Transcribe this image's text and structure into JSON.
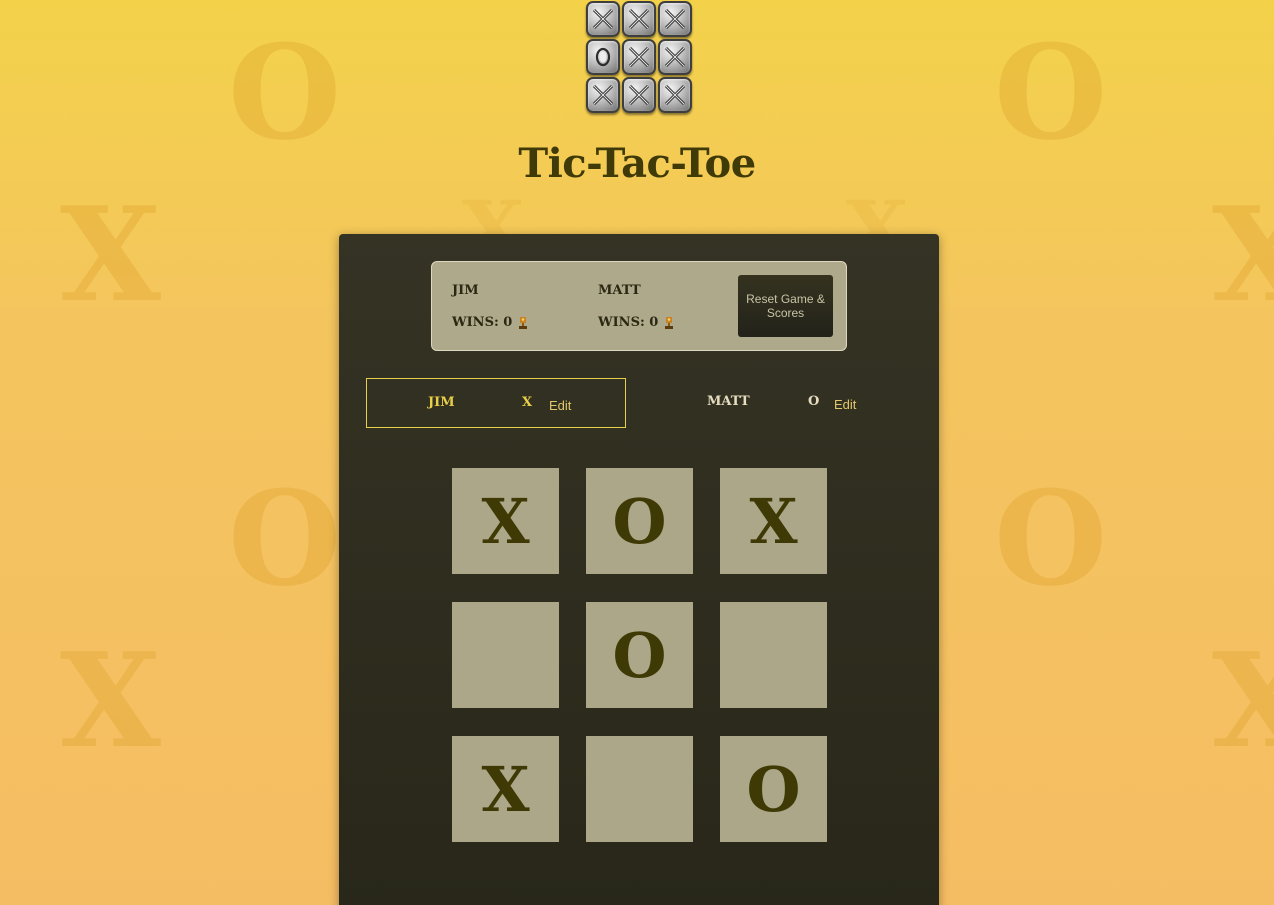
{
  "app": {
    "title": "Tic-Tac-Toe",
    "logo_icon": "tic-tac-toe-logo-icon",
    "logo_tiles": [
      "X",
      "X",
      "X",
      "O",
      "X",
      "X",
      "X",
      "X",
      "X"
    ]
  },
  "background": {
    "glyphs": [
      "O",
      "O",
      "X",
      "X",
      "O",
      "O",
      "X",
      "X",
      "X",
      "X"
    ]
  },
  "scoreboard": {
    "players": [
      {
        "name": "JIM",
        "wins_label": "WINS: 0",
        "trophy_icon": "trophy-icon"
      },
      {
        "name": "MATT",
        "wins_label": "WINS: 0",
        "trophy_icon": "trophy-icon"
      }
    ],
    "reset_label": "Reset Game & Scores"
  },
  "players": [
    {
      "name": "JIM",
      "symbol": "X",
      "edit_label": "Edit",
      "active": true
    },
    {
      "name": "MATT",
      "symbol": "O",
      "edit_label": "Edit",
      "active": false
    }
  ],
  "board": {
    "cells": [
      "X",
      "O",
      "X",
      "",
      "O",
      "",
      "X",
      "",
      "O"
    ]
  },
  "colors": {
    "accent": "#e8cf49",
    "mark": "#3f3a05",
    "panel": "#302e20",
    "cell": "#aca789"
  }
}
